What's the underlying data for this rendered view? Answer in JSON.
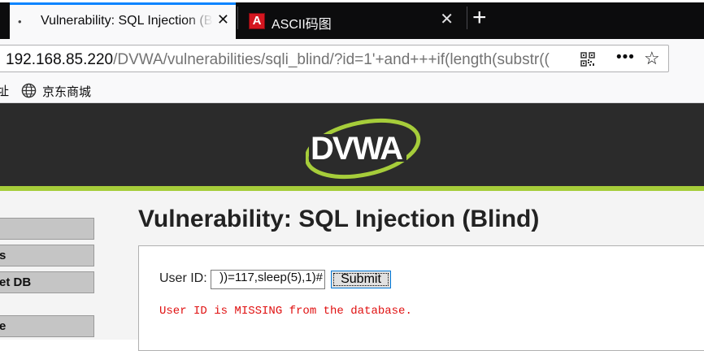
{
  "tabs": [
    {
      "title": "Vulnerability: SQL Injection (B",
      "close": "✕",
      "dot": "•",
      "active": true
    },
    {
      "title": "ASCII码图",
      "close": "✕",
      "favicon_glyph": "A"
    }
  ],
  "new_tab_label": "+",
  "url": {
    "host": "192.168.85.220",
    "path": "/DVWA/vulnerabilities/sqli_blind/?id=1'+and+++if(length(substr(("
  },
  "toolbar": {
    "more_label": "•••",
    "star_label": "☆"
  },
  "bookmarks": {
    "partial_label": "址",
    "items": [
      {
        "label": "京东商城",
        "icon": "globe-icon"
      }
    ]
  },
  "sidebar": {
    "items": [
      {
        "label": ""
      },
      {
        "label": "s"
      },
      {
        "label": "et DB"
      },
      {
        "label": "e"
      }
    ]
  },
  "page": {
    "title": "Vulnerability: SQL Injection (Blind)",
    "form": {
      "user_id_label": "User ID:",
      "user_id_value": "))=117,sleep(5),1)#",
      "submit_label": "Submit"
    },
    "error_message": "User ID is MISSING from the database."
  },
  "colors": {
    "accent": "#0a84ff",
    "dvwa_green": "#a6cd3a",
    "header_bg": "#2b2b2b",
    "error": "#e01010"
  }
}
